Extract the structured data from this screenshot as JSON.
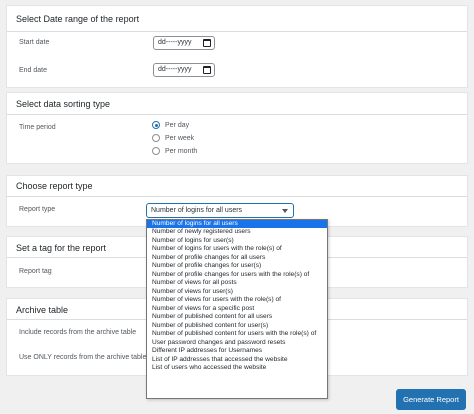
{
  "date_range": {
    "title": "Select Date range of the report",
    "start_label": "Start date",
    "start_value": "dd-----yyyy",
    "end_label": "End date",
    "end_value": "dd-----yyyy"
  },
  "sorting": {
    "title": "Select data sorting type",
    "time_label": "Time period",
    "options": [
      {
        "label": "Per day",
        "checked": true
      },
      {
        "label": "Per week",
        "checked": false
      },
      {
        "label": "Per month",
        "checked": false
      }
    ]
  },
  "report": {
    "title": "Choose report type",
    "type_label": "Report type",
    "selected": "Number of logins for all users",
    "options": [
      "Number of logins for all users",
      "Number of newly registered users",
      "Number of logins for user(s)",
      "Number of logins for users with the role(s) of",
      "Number of profile changes for all users",
      "Number of profile changes for user(s)",
      "Number of profile changes for users with the role(s) of",
      "Number of views for all posts",
      "Number of views for user(s)",
      "Number of views for users with the role(s) of",
      "Number of views for a specific post",
      "Number of published content for all users",
      "Number of published content for user(s)",
      "Number of published content for users with the role(s) of",
      "User password changes and password resets",
      "Different IP addresses for Usernames",
      "List of IP addresses that accessed the website",
      "List of users who accessed the website"
    ]
  },
  "tag": {
    "title": "Set a tag for the report",
    "label": "Report tag"
  },
  "archive": {
    "title": "Archive table",
    "include_label": "Include records from the archive table",
    "only_label": "Use ONLY records from the archive table"
  },
  "actions": {
    "generate_label": "Generate Report"
  },
  "colors": {
    "accent": "#2271b1",
    "highlight": "#1a73e8",
    "background": "#f0f0f1"
  }
}
